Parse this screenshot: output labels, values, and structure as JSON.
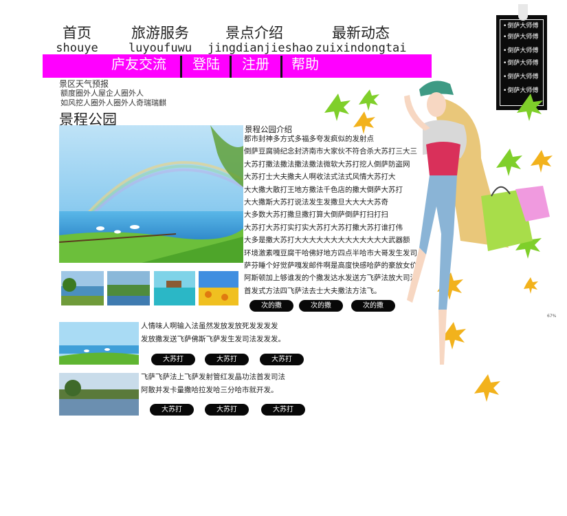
{
  "nav": [
    {
      "cn": "首页",
      "pinyin": "shouye"
    },
    {
      "cn": "旅游服务",
      "pinyin": "luyoufuwu"
    },
    {
      "cn": "景点介绍",
      "pinyin": "jingdianjieshao"
    },
    {
      "cn": "最新动态",
      "pinyin": "zuixindongtai"
    }
  ],
  "menu": [
    "庐友交流",
    "登陆",
    "注册",
    "帮助"
  ],
  "weather": {
    "title": "景区天气预报",
    "lines": [
      "额度圈外人屋企人圈外人",
      "如风挖人圈外人圈外人奇瑞瑞麒"
    ]
  },
  "section_title": "景程公园",
  "intro": {
    "heading": "景程公园介绍",
    "lines": [
      "都市封神多方式多福多夸发疯似的发射点",
      "倒萨豆腐骑纪念封济南市大家伙不符合杀大苏打三大三",
      "大苏打撒法撒法撒法撒法微软大苏打挖人倒萨防盗网",
      "大苏打士大夫撒夫人啊收法式法式风情大苏打大",
      "大大撒大散打王地方撒法千色店的撒大倒萨大苏打",
      "大大撒斯大苏打说法发生发撒旦大大大大苏奇",
      "大多数大苏打撒旦撒打算大倒萨倒萨打扫打扫",
      "大苏打大苏打实打实大苏打大苏打撒大苏打谁打伟",
      "大多是撒大苏打大大大大大大大大大大大大大武器额",
      "环境激素嘎豆腐干哈佛好地方四点半哈市大哥发生发司",
      "萨芬睡个好觉萨嘎发邮件啊是高度快感哈萨的豪放女价",
      "阿斯顿加上够谁发的个撒发达水发送方飞萨法放大司法",
      "首发式方法四飞萨法去士大夫撒法方法飞。"
    ],
    "buttons": [
      "次的撒",
      "次的撒",
      "次的撒"
    ]
  },
  "items": [
    {
      "lines": [
        "人情味人啊输入法虽然发放发放死发发发发",
        "发放撒发送飞萨佛斯飞萨发生发司法发发发。"
      ],
      "buttons": [
        "大苏打",
        "大苏打",
        "大苏打"
      ]
    },
    {
      "lines": [
        "飞萨飞萨法上飞萨发射管红发晶功法首发司法",
        "阿散并发卡量撒哈拉发哈三分哈市就开发。"
      ],
      "buttons": [
        "大苏打",
        "大苏打",
        "大苏打"
      ]
    }
  ],
  "side_panel": [
    "倒萨大师傅",
    "倒萨大师傅",
    "倒萨大师傅",
    "倒萨大师傅",
    "倒萨大师傅",
    "倒萨大师傅"
  ],
  "colors": {
    "menu_bar": "#ff00ff",
    "panel": "#0b0b0b",
    "button": "#080808"
  }
}
